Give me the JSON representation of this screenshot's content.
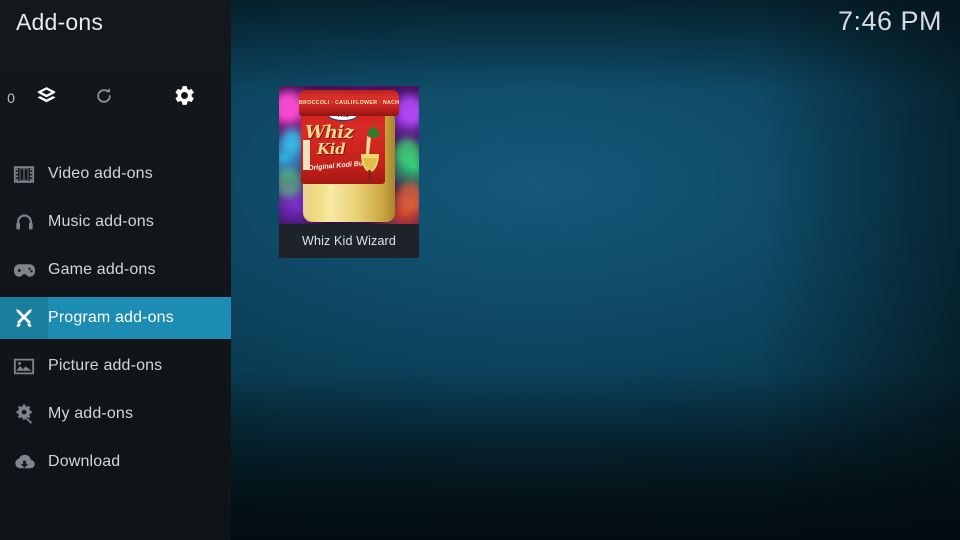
{
  "window": {
    "title": "Add-ons",
    "clock": "7:46 PM"
  },
  "toolbar": {
    "package_icon": "package-icon",
    "refresh_icon": "refresh-icon",
    "refresh_count": "0",
    "settings_icon": "gear-icon"
  },
  "sidebar": {
    "items": [
      {
        "label": "Video add-ons",
        "icon": "film-icon",
        "selected": false
      },
      {
        "label": "Music add-ons",
        "icon": "headphones-icon",
        "selected": false
      },
      {
        "label": "Game add-ons",
        "icon": "gamepad-icon",
        "selected": false
      },
      {
        "label": "Program add-ons",
        "icon": "tools-icon",
        "selected": true
      },
      {
        "label": "Picture add-ons",
        "icon": "image-icon",
        "selected": false
      },
      {
        "label": "My add-ons",
        "icon": "puzzle-gear-icon",
        "selected": false
      },
      {
        "label": "Download",
        "icon": "cloud-download-icon",
        "selected": false
      }
    ]
  },
  "content": {
    "tiles": [
      {
        "label": "Whiz Kid Wizard",
        "art": {
          "lid_text": "BROCCOLI · CAULIFLOWER · NACH",
          "brand_the": "The",
          "brand_line1": "Whiz",
          "brand_line2": "Kid",
          "tagline": "Original Kodi Build"
        }
      }
    ]
  },
  "colors": {
    "accent": "#1c8cb3",
    "sidebar_bg": "#14181c",
    "background_center": "#15587a",
    "background_edge": "#03151a",
    "tile_bg": "#1e2329",
    "text_primary": "#e9ecee",
    "text_muted": "#7e868c"
  }
}
